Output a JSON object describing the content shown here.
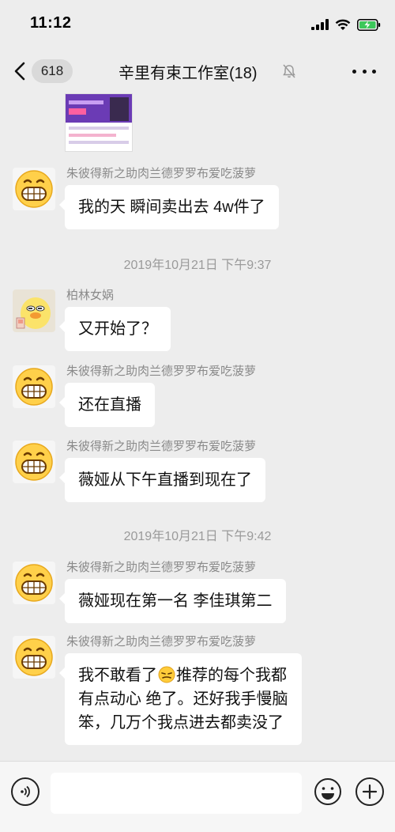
{
  "status_bar": {
    "time": "11:12",
    "icons": [
      "cellular-signal-icon",
      "wifi-icon",
      "battery-charging-icon"
    ]
  },
  "nav": {
    "unread_count": "618",
    "title": "辛里有束工作室(18)",
    "icons": [
      "back-chevron-icon",
      "mute-bell-icon",
      "more-icon"
    ]
  },
  "messages": [
    {
      "type": "text",
      "sender": "朱彼得新之助肉兰德罗罗布爱吃菠萝",
      "avatar": "grin-emoji",
      "text": "我的天 瞬间卖出去 4w件了"
    },
    {
      "type": "time",
      "text": "2019年10月21日 下午9:37"
    },
    {
      "type": "text",
      "sender": "柏林女娲",
      "avatar": "cartoon-duck",
      "text": "又开始了？"
    },
    {
      "type": "text",
      "sender": "朱彼得新之助肉兰德罗罗布爱吃菠萝",
      "avatar": "grin-emoji",
      "text": "还在直播"
    },
    {
      "type": "text",
      "sender": "朱彼得新之助肉兰德罗罗布爱吃菠萝",
      "avatar": "grin-emoji",
      "text": "薇娅从下午直播到现在了"
    },
    {
      "type": "time",
      "text": "2019年10月21日 下午9:42"
    },
    {
      "type": "text",
      "sender": "朱彼得新之助肉兰德罗罗布爱吃菠萝",
      "avatar": "grin-emoji",
      "text": "薇娅现在第一名 李佳琪第二"
    },
    {
      "type": "text",
      "sender": "朱彼得新之助肉兰德罗罗布爱吃菠萝",
      "avatar": "grin-emoji",
      "lines": [
        "我不敢看了",
        "推荐的每个我都",
        "有点动心 绝了。还好我手慢脑",
        "笨，几万个我点进去都卖没了"
      ]
    }
  ],
  "input_bar": {
    "placeholder": "",
    "icons": [
      "voice-icon",
      "emoji-icon",
      "plus-icon"
    ]
  },
  "colors": {
    "background": "#ededed",
    "bubble": "#ffffff",
    "timestamp_text": "#9a9a9a",
    "sender_text": "#8a8a8a"
  }
}
